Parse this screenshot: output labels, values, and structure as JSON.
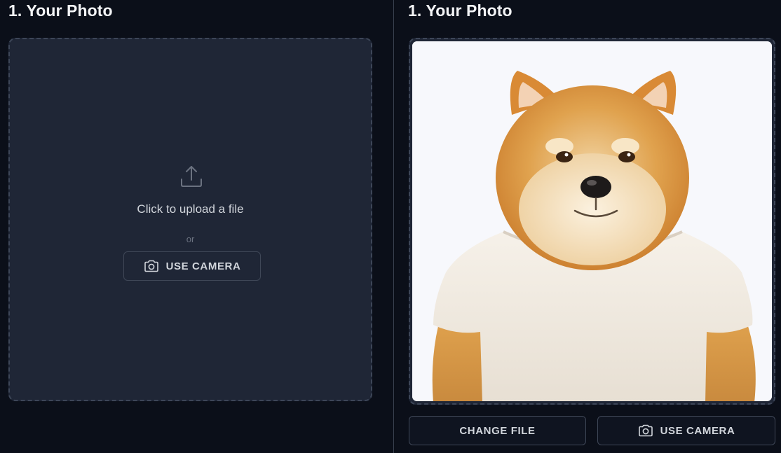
{
  "left_panel": {
    "title": "1. Your Photo",
    "upload_text": "Click to upload a file",
    "or_text": "or",
    "camera_label": "USE CAMERA"
  },
  "right_panel": {
    "title": "1. Your Photo",
    "change_file_label": "CHANGE FILE",
    "camera_label": "USE CAMERA"
  },
  "icons": {
    "upload": "upload-icon",
    "camera": "camera-icon"
  },
  "colors": {
    "background": "#0b0f19",
    "dropzone": "#1f2636",
    "dashed_border": "#3d4658",
    "button_border": "#3f4757"
  }
}
